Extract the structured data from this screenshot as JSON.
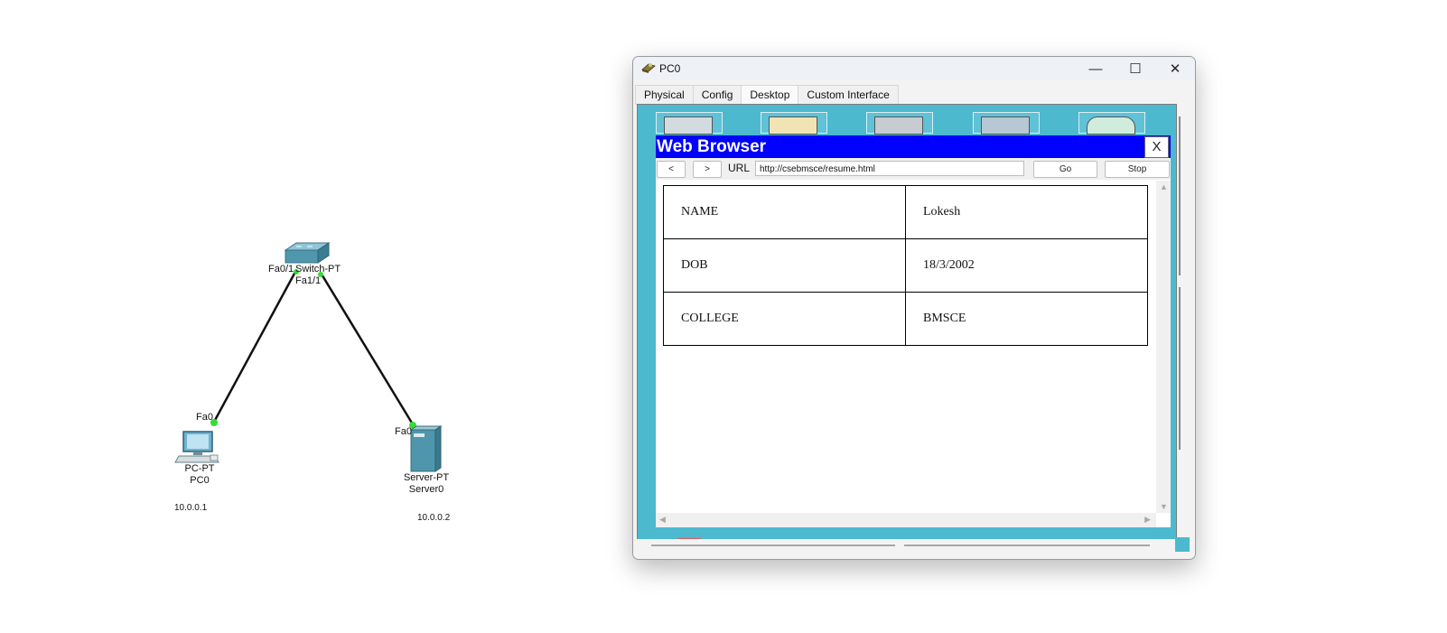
{
  "topology": {
    "switch": {
      "name": "Switch-PT",
      "port_left": "Fa0/1",
      "port_right": "Fa1/1"
    },
    "pc": {
      "type": "PC-PT",
      "name": "PC0",
      "port": "Fa0",
      "ip": "10.0.0.1"
    },
    "server": {
      "type": "Server-PT",
      "name": "Server0",
      "port": "Fa0",
      "ip": "10.0.0.2"
    }
  },
  "window": {
    "title": "PC0",
    "tabs": [
      "Physical",
      "Config",
      "Desktop",
      "Custom Interface"
    ],
    "active_tab": "Desktop",
    "minimize": "—",
    "maximize": "☐",
    "close": "✕"
  },
  "browser": {
    "title": "Web Browser",
    "close_label": "X",
    "back_label": "<",
    "forward_label": ">",
    "url_label": "URL",
    "url_value": "http://csebmsce/resume.html",
    "go_label": "Go",
    "stop_label": "Stop"
  },
  "resume_table": {
    "rows": [
      [
        "NAME",
        "Lokesh"
      ],
      [
        "DOB",
        "18/3/2002"
      ],
      [
        "COLLEGE",
        "BMSCE"
      ]
    ]
  },
  "colors": {
    "browser_header": "#0000ff",
    "desktop_bg": "#4cb9cf",
    "link_indicator": "#33dd33"
  }
}
